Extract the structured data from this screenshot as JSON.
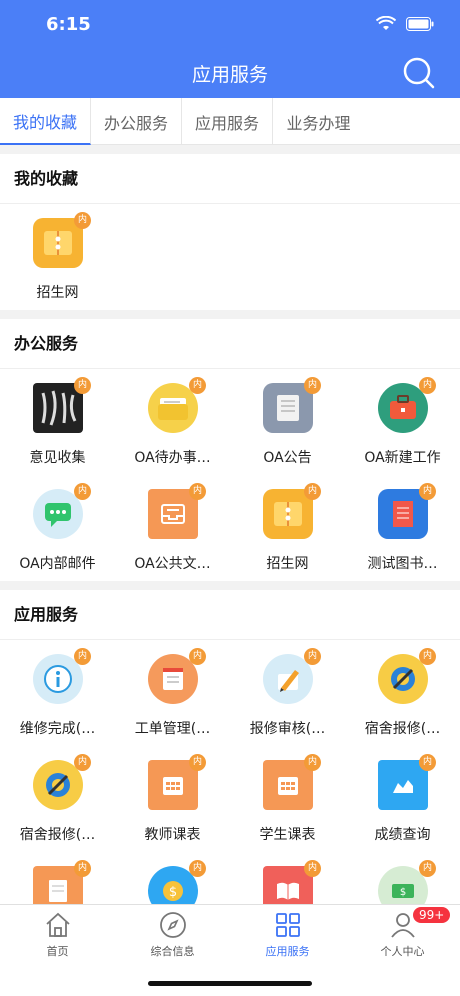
{
  "status_bar": {
    "time": "6:15"
  },
  "header": {
    "title": "应用服务"
  },
  "tabs": [
    {
      "label": "我的收藏"
    },
    {
      "label": "办公服务"
    },
    {
      "label": "应用服务"
    },
    {
      "label": "业务办理"
    }
  ],
  "badge_text": "内",
  "sections": {
    "favorites": {
      "title": "我的收藏",
      "items": [
        {
          "label": "招生网",
          "icon": "envelope-icon"
        }
      ]
    },
    "office": {
      "title": "办公服务",
      "items": [
        {
          "label": "意见收集",
          "icon": "calligraphy-icon"
        },
        {
          "label": "OA待办事…",
          "icon": "folder-icon"
        },
        {
          "label": "OA公告",
          "icon": "notice-board-icon"
        },
        {
          "label": "OA新建工作",
          "icon": "briefcase-icon"
        },
        {
          "label": "OA内部邮件",
          "icon": "chat-icon"
        },
        {
          "label": "OA公共文…",
          "icon": "inbox-tray-icon"
        },
        {
          "label": "招生网",
          "icon": "envelope-icon"
        },
        {
          "label": "测试图书…",
          "icon": "document-icon"
        }
      ]
    },
    "apps": {
      "title": "应用服务",
      "items": [
        {
          "label": "维修完成(…",
          "icon": "info-icon"
        },
        {
          "label": "工单管理(…",
          "icon": "list-icon"
        },
        {
          "label": "报修审核(…",
          "icon": "pen-icon"
        },
        {
          "label": "宿舍报修(…",
          "icon": "wrench-gear-icon"
        },
        {
          "label": "宿舍报修(…",
          "icon": "wrench-gear-icon"
        },
        {
          "label": "教师课表",
          "icon": "calendar-icon"
        },
        {
          "label": "学生课表",
          "icon": "calendar-icon"
        },
        {
          "label": "成绩查询",
          "icon": "area-chart-icon"
        },
        {
          "label": "",
          "icon": "form-icon"
        },
        {
          "label": "",
          "icon": "coin-icon"
        },
        {
          "label": "",
          "icon": "book-icon"
        },
        {
          "label": "",
          "icon": "money-icon"
        }
      ]
    }
  },
  "tabbar": [
    {
      "label": "首页",
      "icon": "home-icon"
    },
    {
      "label": "综合信息",
      "icon": "compass-icon"
    },
    {
      "label": "应用服务",
      "icon": "grid-icon"
    },
    {
      "label": "个人中心",
      "icon": "person-icon",
      "badge": "99+"
    }
  ],
  "colors": {
    "primary": "#4b7ff7",
    "active": "#3b72f5",
    "badge": "#f39b37",
    "notif": "#f5333f"
  }
}
